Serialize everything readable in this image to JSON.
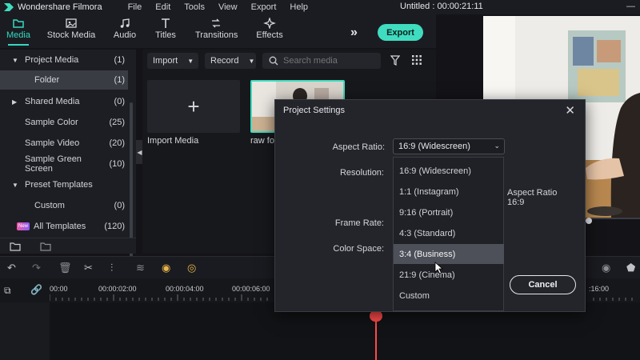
{
  "titlebar": {
    "app_name": "Wondershare Filmora",
    "menu": [
      "File",
      "Edit",
      "Tools",
      "View",
      "Export",
      "Help"
    ],
    "document": "Untitled : 00:00:21:11",
    "window_buttons": [
      "—"
    ]
  },
  "toolbar": {
    "tabs": [
      {
        "label": "Media",
        "icon": "folder-icon"
      },
      {
        "label": "Stock Media",
        "icon": "image-icon"
      },
      {
        "label": "Audio",
        "icon": "music-note-icon"
      },
      {
        "label": "Titles",
        "icon": "text-icon"
      },
      {
        "label": "Transitions",
        "icon": "transition-icon"
      },
      {
        "label": "Effects",
        "icon": "sparkle-icon"
      }
    ],
    "export_label": "Export",
    "accent": "#35d9c2"
  },
  "sidebar": {
    "items": [
      {
        "label": "Project Media",
        "count": "(1)"
      },
      {
        "label": "Folder",
        "count": "(1)"
      },
      {
        "label": "Shared Media",
        "count": "(0)"
      },
      {
        "label": "Sample Color",
        "count": "(25)"
      },
      {
        "label": "Sample Video",
        "count": "(20)"
      },
      {
        "label": "Sample Green Screen",
        "count": "(10)"
      },
      {
        "label": "Preset Templates",
        "count": ""
      },
      {
        "label": "Custom",
        "count": "(0)"
      },
      {
        "label": "All Templates",
        "count": "(120)"
      }
    ]
  },
  "media": {
    "import_label": "Import",
    "record_label": "Record",
    "search_placeholder": "Search media",
    "import_tile_label": "Import Media",
    "clip_label": "raw fo"
  },
  "timeline": {
    "ruler": [
      "00:00",
      "00:00:02:00",
      "00:00:04:00",
      "00:00:06:00",
      ":16:00"
    ]
  },
  "modal": {
    "title": "Project Settings",
    "close": "✕",
    "aspect_ratio_label": "Aspect Ratio:",
    "resolution_label": "Resolution:",
    "frame_rate_label": "Frame Rate:",
    "color_space_label": "Color Space:",
    "aspect_selected": "16:9 (Widescreen)",
    "aspect_info_title": "Aspect Ratio",
    "aspect_info_value": "16:9",
    "cancel_label": "Cancel",
    "options": [
      "16:9 (Widescreen)",
      "1:1 (Instagram)",
      "9:16 (Portrait)",
      "4:3 (Standard)",
      "3:4 (Business)",
      "21:9 (Cinema)",
      "Custom"
    ],
    "hovered_option": "3:4 (Business)"
  }
}
